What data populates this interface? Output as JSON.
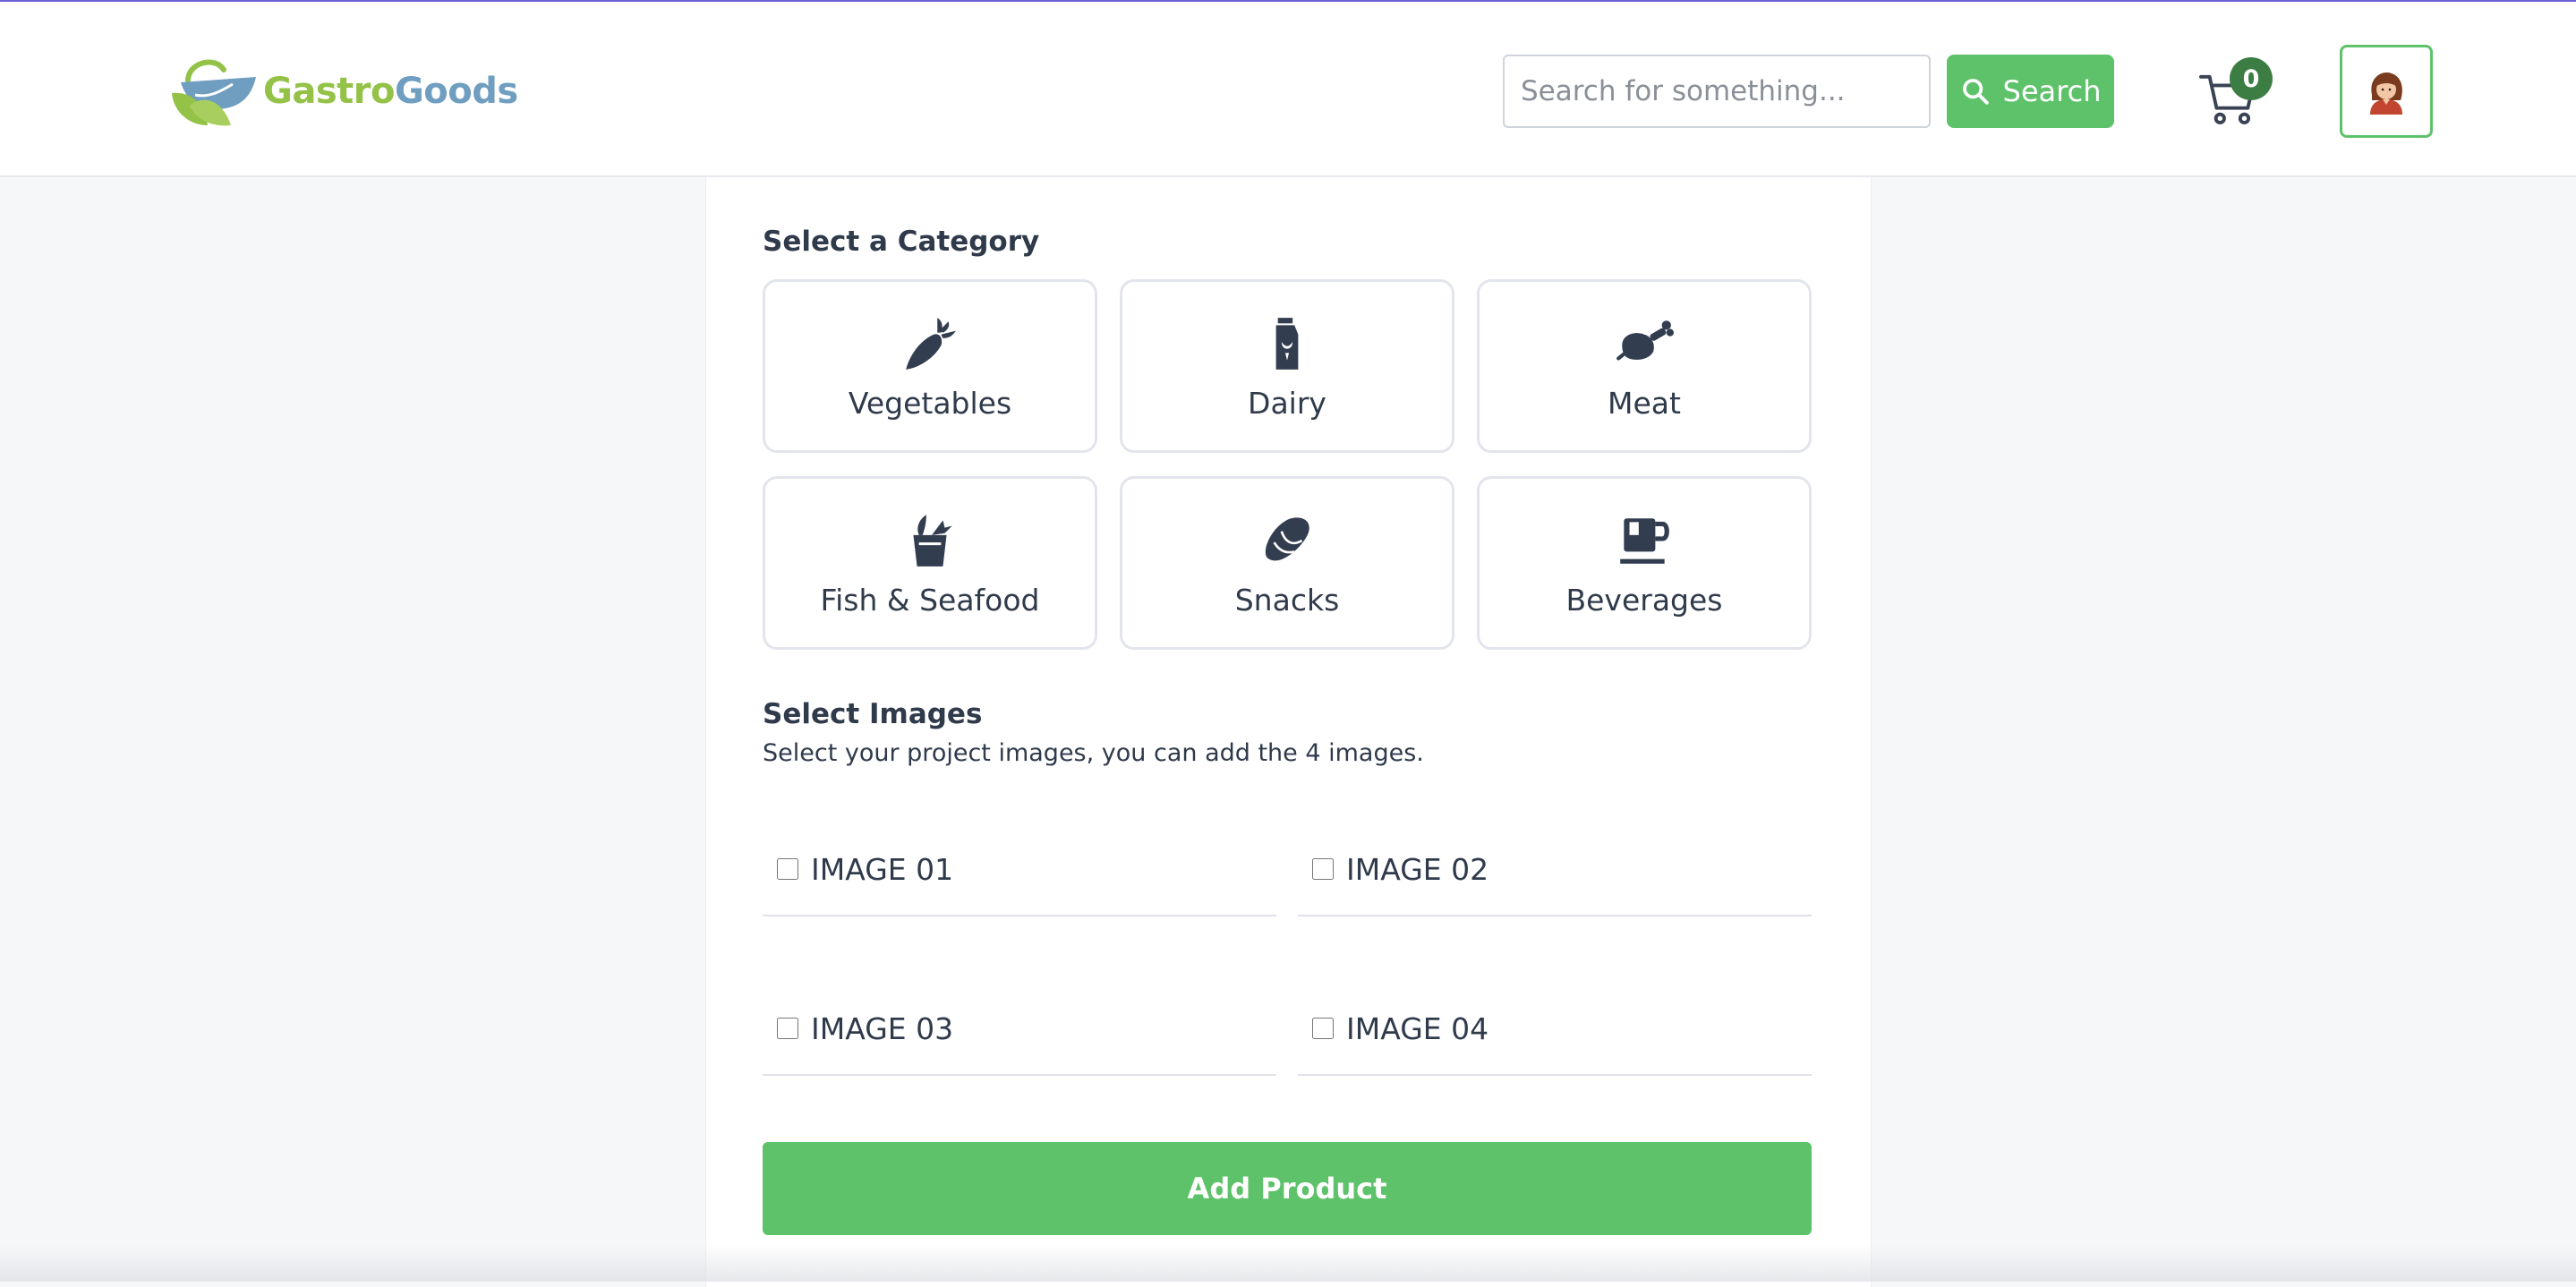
{
  "brand": {
    "name_part1": "Gastro",
    "name_part2": "Goods",
    "logo_icon": "basket-leaf-logo"
  },
  "header": {
    "search_placeholder": "Search for something...",
    "search_value": "",
    "search_button_label": "Search",
    "search_icon": "search-icon",
    "cart_icon": "cart-icon",
    "cart_count": "0",
    "avatar_icon": "user-avatar-icon",
    "accent_color": "#5ec26a",
    "badge_color": "#3c7d43"
  },
  "category_section": {
    "title": "Select a Category",
    "items": [
      {
        "label": "Vegetables",
        "icon": "carrot-icon"
      },
      {
        "label": "Dairy",
        "icon": "milk-carton-icon"
      },
      {
        "label": "Meat",
        "icon": "meat-icon"
      },
      {
        "label": "Fish & Seafood",
        "icon": "fish-bucket-icon"
      },
      {
        "label": "Snacks",
        "icon": "snack-icon"
      },
      {
        "label": "Beverages",
        "icon": "cup-icon"
      }
    ]
  },
  "images_section": {
    "title": "Select Images",
    "subtitle": "Select your project images, you can add the 4 images.",
    "options": [
      {
        "label": "IMAGE 01",
        "checked": false
      },
      {
        "label": "IMAGE 02",
        "checked": false
      },
      {
        "label": "IMAGE 03",
        "checked": false
      },
      {
        "label": "IMAGE 04",
        "checked": false
      }
    ]
  },
  "submit": {
    "label": "Add Product"
  }
}
